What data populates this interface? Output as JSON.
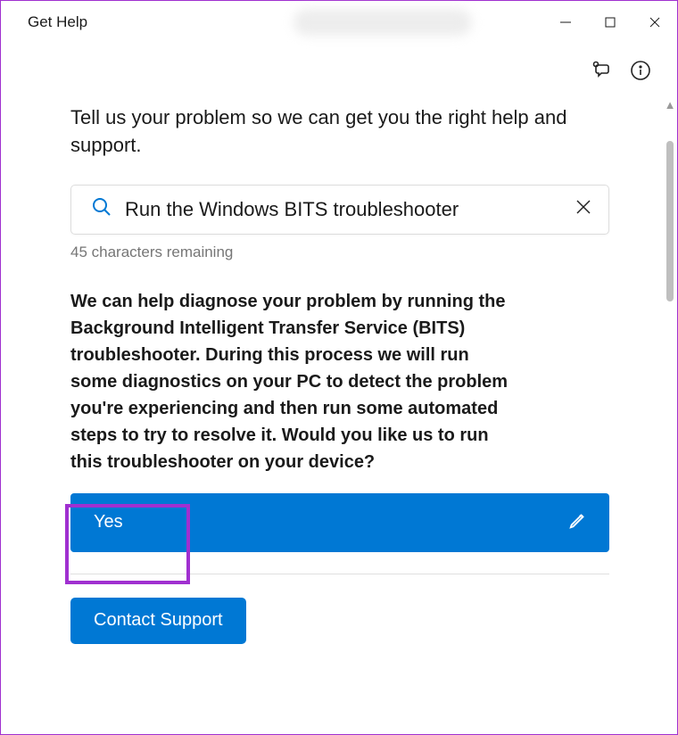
{
  "titlebar": {
    "title": "Get Help"
  },
  "content": {
    "prompt": "Tell us your problem so we can get you the right help and support.",
    "search_value": "Run the Windows BITS troubleshooter",
    "chars_remaining": "45 characters remaining",
    "diagnosis": "We can help diagnose your problem by running the Background Intelligent Transfer Service (BITS) troubleshooter. During this process we will run some diagnostics on your PC to detect the problem you're experiencing and then run some automated steps to try to resolve it. Would you like us to run this troubleshooter on your device?",
    "yes_label": "Yes",
    "contact_label": "Contact Support"
  }
}
